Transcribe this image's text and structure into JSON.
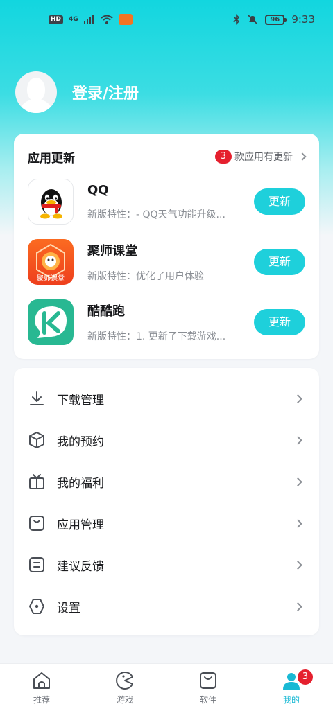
{
  "status_bar": {
    "left_tags": [
      "HD",
      "4G"
    ],
    "battery": "96",
    "time": "9:33"
  },
  "profile": {
    "login_label": "登录/注册"
  },
  "updates": {
    "title": "应用更新",
    "count": "3",
    "count_suffix": "款应用有更新",
    "apps": [
      {
        "name": "QQ",
        "desc": "新版特性：- QQ天气功能升级...",
        "button": "更新",
        "icon": "qq-icon"
      },
      {
        "name": "聚师课堂",
        "desc": "新版特性：优化了用户体验",
        "button": "更新",
        "icon": "jushi-ketang-icon",
        "icon_text": "聚师课堂"
      },
      {
        "name": "酷酷跑",
        "desc": "新版特性：1. 更新了下载游戏...",
        "button": "更新",
        "icon": "kukupao-icon"
      }
    ]
  },
  "menu": [
    {
      "label": "下载管理",
      "icon": "download-icon"
    },
    {
      "label": "我的预约",
      "icon": "cube-icon"
    },
    {
      "label": "我的福利",
      "icon": "gift-icon"
    },
    {
      "label": "应用管理",
      "icon": "app-manage-icon"
    },
    {
      "label": "建议反馈",
      "icon": "feedback-icon"
    },
    {
      "label": "设置",
      "icon": "settings-icon"
    }
  ],
  "tabs": [
    {
      "label": "推荐",
      "icon": "home-icon"
    },
    {
      "label": "游戏",
      "icon": "game-icon"
    },
    {
      "label": "软件",
      "icon": "bag-icon"
    },
    {
      "label": "我的",
      "icon": "user-icon",
      "badge": "3",
      "active": true
    }
  ],
  "colors": {
    "accent": "#1ed0db",
    "badge_red": "#e5202e",
    "header_gradient_top": "#12d6df"
  }
}
